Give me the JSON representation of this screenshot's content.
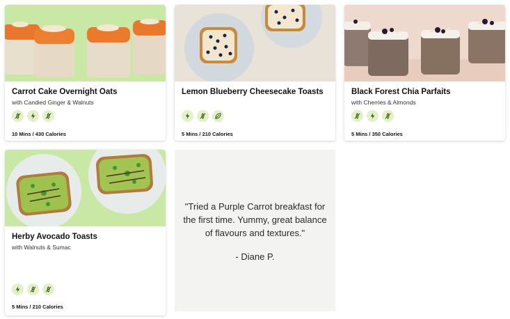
{
  "cards": [
    {
      "title": "Carrot Cake Overnight Oats",
      "subtitle": "with Candied Ginger & Walnuts",
      "icons": [
        "no-gluten-icon",
        "energy-bolt-icon",
        "no-gluten-icon"
      ],
      "meta": "10 Mins / 430 Calories",
      "photo_bg": "#c9e8a6"
    },
    {
      "title": "Lemon Blueberry Cheesecake Toasts",
      "subtitle": "",
      "icons": [
        "energy-bolt-icon",
        "no-gluten-icon",
        "leaf-icon"
      ],
      "meta": "5 Mins / 210 Calories",
      "photo_bg": "#e9e2d8"
    },
    {
      "title": "Black Forest Chia Parfaits",
      "subtitle": "with Cherries & Almonds",
      "icons": [
        "no-gluten-icon",
        "energy-bolt-icon",
        "no-gluten-icon"
      ],
      "meta": "5 Mins / 350 Calories",
      "photo_bg": "#eed9cf"
    },
    {
      "title": "Herby Avocado Toasts",
      "subtitle": "with Walnuts & Sumac",
      "icons": [
        "energy-bolt-icon",
        "no-gluten-icon",
        "no-gluten-icon"
      ],
      "meta": "5 Mins / 210 Calories",
      "photo_bg": "#c9e8a6"
    }
  ],
  "testimonial": {
    "quote": "\"Tried a Purple Carrot breakfast for the first time. Yummy, great balance of flavours and textures.\"",
    "author": "- Diane P."
  },
  "colors": {
    "badge_bg": "#e4f1c8",
    "badge_icon": "#3a5a1a",
    "quote_bg": "#f3f3f1"
  }
}
